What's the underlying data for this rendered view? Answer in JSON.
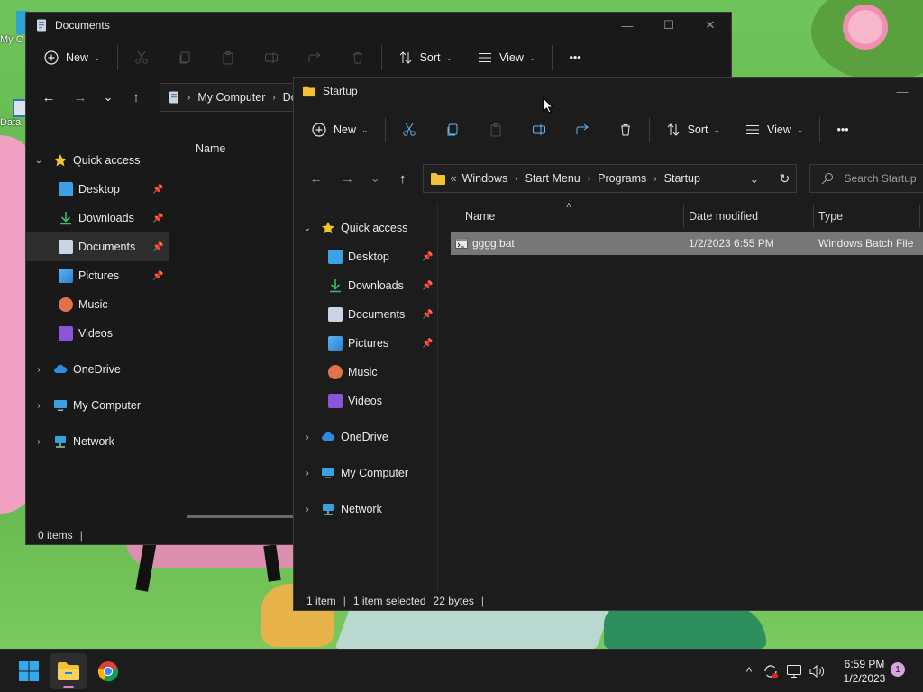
{
  "desktop": {
    "icons": [
      {
        "label": "My C",
        "icon": "my-computer-icon"
      },
      {
        "label": "Data",
        "icon": "shortcut-icon"
      }
    ]
  },
  "docs_window": {
    "title": "Documents",
    "controls": {
      "minimize": "—",
      "maximize": "☐",
      "close": "✕"
    },
    "command_bar": {
      "new": "New",
      "sort": "Sort",
      "view": "View",
      "more": "•••"
    },
    "nav": {
      "back": "←",
      "forward": "→",
      "recent": "⌄",
      "up": "↑"
    },
    "address": {
      "segments": [
        "My Computer",
        "Doc"
      ]
    },
    "sidebar": {
      "quick_access": "Quick access",
      "items": [
        {
          "label": "Desktop",
          "icon": "desktop-icon",
          "pinned": true
        },
        {
          "label": "Downloads",
          "icon": "downloads-icon",
          "pinned": true
        },
        {
          "label": "Documents",
          "icon": "documents-icon",
          "pinned": true,
          "selected": true
        },
        {
          "label": "Pictures",
          "icon": "pictures-icon",
          "pinned": true
        },
        {
          "label": "Music",
          "icon": "music-icon",
          "pinned": false
        },
        {
          "label": "Videos",
          "icon": "videos-icon",
          "pinned": false
        }
      ],
      "onedrive": "OneDrive",
      "my_computer": "My Computer",
      "network": "Network"
    },
    "columns": {
      "name": "Name"
    },
    "status": {
      "items": "0 items",
      "sep": "|"
    }
  },
  "startup_window": {
    "title": "Startup",
    "controls": {
      "minimize": "—"
    },
    "command_bar": {
      "new": "New",
      "sort": "Sort",
      "view": "View",
      "more": "•••"
    },
    "nav": {
      "back": "←",
      "forward": "→",
      "recent": "⌄",
      "up": "↑"
    },
    "address": {
      "overflow": "«",
      "segments": [
        "Windows",
        "Start Menu",
        "Programs",
        "Startup"
      ],
      "dropdown": "⌄",
      "refresh": "↻"
    },
    "search": {
      "placeholder": "Search Startup"
    },
    "sidebar": {
      "quick_access": "Quick access",
      "items": [
        {
          "label": "Desktop",
          "icon": "desktop-icon",
          "pinned": true
        },
        {
          "label": "Downloads",
          "icon": "downloads-icon",
          "pinned": true
        },
        {
          "label": "Documents",
          "icon": "documents-icon",
          "pinned": true
        },
        {
          "label": "Pictures",
          "icon": "pictures-icon",
          "pinned": true
        },
        {
          "label": "Music",
          "icon": "music-icon",
          "pinned": false
        },
        {
          "label": "Videos",
          "icon": "videos-icon",
          "pinned": false
        }
      ],
      "onedrive": "OneDrive",
      "my_computer": "My Computer",
      "network": "Network"
    },
    "columns": {
      "name": "Name",
      "date_modified": "Date modified",
      "type": "Type"
    },
    "files": [
      {
        "name": "gggg.bat",
        "date_modified": "1/2/2023 6:55 PM",
        "type": "Windows Batch File",
        "selected": true
      }
    ],
    "status": {
      "items": "1 item",
      "selected": "1 item selected",
      "size": "22 bytes",
      "sep": "|"
    }
  },
  "taskbar": {
    "apps": [
      {
        "name": "Start",
        "icon": "windows-start-icon"
      },
      {
        "name": "File Explorer",
        "icon": "file-explorer-icon",
        "active": true
      },
      {
        "name": "Google Chrome",
        "icon": "chrome-icon"
      }
    ],
    "tray": {
      "chevron": "^",
      "clock_time": "6:59 PM",
      "clock_date": "1/2/2023",
      "notifications": "1"
    }
  },
  "colors": {
    "window_bg": "#191919",
    "selection_gray": "#777777",
    "folder_yellow": "#f2c037",
    "accent_blue": "#3ba0e6",
    "taskbar_bg": "#1c1c1c"
  }
}
